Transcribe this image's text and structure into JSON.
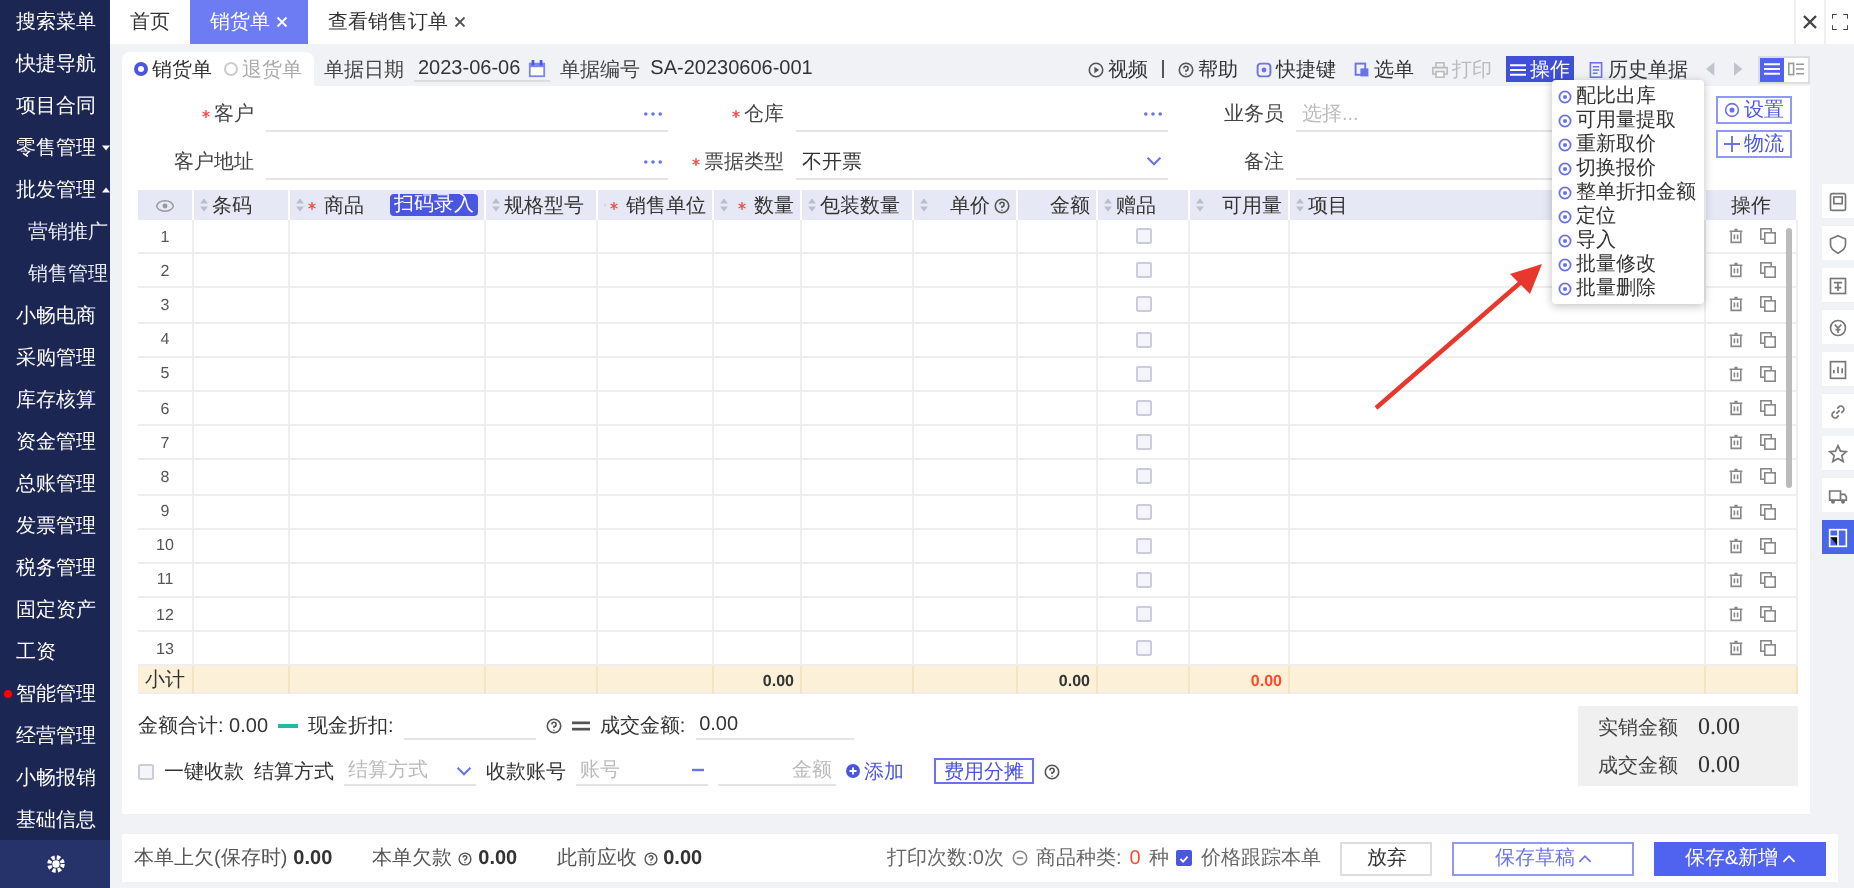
{
  "sidebar": {
    "items": [
      {
        "label": "搜索菜单",
        "notice": false
      },
      {
        "label": "快捷导航",
        "notice": false
      },
      {
        "label": "项目合同",
        "notice": false
      },
      {
        "label": "零售管理",
        "notice": false,
        "expanded": false
      },
      {
        "label": "批发管理",
        "notice": false,
        "expanded": true,
        "children": [
          {
            "label": "营销推广",
            "notice": false
          },
          {
            "label": "销售管理",
            "notice": false
          }
        ]
      },
      {
        "label": "小畅电商",
        "notice": false
      },
      {
        "label": "采购管理",
        "notice": false
      },
      {
        "label": "库存核算",
        "notice": false
      },
      {
        "label": "资金管理",
        "notice": false
      },
      {
        "label": "总账管理",
        "notice": false
      },
      {
        "label": "发票管理",
        "notice": false
      },
      {
        "label": "税务管理",
        "notice": false
      },
      {
        "label": "固定资产",
        "notice": false
      },
      {
        "label": "工资",
        "notice": false
      },
      {
        "label": "智能管理",
        "notice": true
      },
      {
        "label": "经营管理",
        "notice": false
      },
      {
        "label": "小畅报销",
        "notice": false
      },
      {
        "label": "基础信息",
        "notice": false
      }
    ]
  },
  "tabs": [
    {
      "label": "首页",
      "closable": false,
      "selected": false
    },
    {
      "label": "销货单",
      "closable": true,
      "selected": true
    },
    {
      "label": "查看销售订单",
      "closable": true,
      "selected": false
    }
  ],
  "doc_types": [
    {
      "label": "销货单",
      "selected": true
    },
    {
      "label": "退货单",
      "selected": false
    }
  ],
  "doc_date": {
    "label": "单据日期",
    "value": "2023-06-06"
  },
  "doc_number": {
    "label": "单据编号",
    "value": "SA-20230606-001"
  },
  "toolbar": [
    {
      "label": "视频",
      "kind": "video",
      "disabled": false,
      "expanded": false
    },
    {
      "label": "帮助",
      "kind": "help",
      "disabled": false,
      "expanded": false
    },
    {
      "label": "快捷键",
      "kind": "keyboard",
      "disabled": false,
      "expanded": false
    },
    {
      "label": "选单",
      "kind": "list",
      "disabled": false,
      "expanded": false
    },
    {
      "label": "打印",
      "kind": "print",
      "disabled": true,
      "expanded": false
    },
    {
      "label": "操作",
      "kind": "menu",
      "disabled": false,
      "expanded": true
    },
    {
      "label": "历史单据",
      "kind": "history",
      "disabled": false,
      "expanded": false
    }
  ],
  "view_toggle": [
    {
      "kind": "list",
      "selected": true
    },
    {
      "kind": "detail",
      "selected": false
    }
  ],
  "form_rows": [
    [
      {
        "label": "客户",
        "required": true,
        "kind": "lookup"
      },
      {
        "label": "仓库",
        "required": true,
        "kind": "lookup"
      },
      {
        "label": "业务员",
        "required": false,
        "kind": "lookup",
        "placeholder": "选择..."
      }
    ],
    [
      {
        "label": "客户地址",
        "required": false,
        "kind": "lookup"
      },
      {
        "label": "票据类型",
        "required": true,
        "kind": "select",
        "value": "不开票"
      },
      {
        "label": "备注",
        "required": false,
        "kind": "text"
      }
    ]
  ],
  "side_buttons": [
    {
      "label": "设置",
      "kind": "settings"
    },
    {
      "label": "物流",
      "kind": "add"
    }
  ],
  "operation_menu": [
    {
      "label": "配比出库"
    },
    {
      "label": "可用量提取"
    },
    {
      "label": "重新取价"
    },
    {
      "label": "切换报价"
    },
    {
      "label": "整单折扣金额"
    },
    {
      "label": "定位"
    },
    {
      "label": "导入"
    },
    {
      "label": "批量修改"
    },
    {
      "label": "批量删除"
    }
  ],
  "table": {
    "columns": [
      {
        "kind": "index",
        "total": "小计"
      },
      {
        "kind": "text",
        "label": "条码",
        "sortable": true,
        "required": false
      },
      {
        "kind": "text",
        "label": "商品",
        "sortable": true,
        "required": true,
        "badge": "扫码录入"
      },
      {
        "kind": "text",
        "label": "规格型号",
        "sortable": true,
        "required": false
      },
      {
        "kind": "text",
        "label": "销售单位",
        "sortable": true,
        "required": true
      },
      {
        "kind": "number",
        "label": "数量",
        "sortable": true,
        "required": true,
        "total": "0.00",
        "warning": false
      },
      {
        "kind": "text",
        "label": "包装数量",
        "sortable": true,
        "required": false
      },
      {
        "kind": "number",
        "label": "单价",
        "sortable": true,
        "required": false,
        "help": true
      },
      {
        "kind": "number",
        "label": "金额",
        "sortable": false,
        "required": false,
        "total": "0.00",
        "warning": false
      },
      {
        "kind": "check",
        "label": "赠品",
        "sortable": true,
        "required": false
      },
      {
        "kind": "number",
        "label": "可用量",
        "sortable": true,
        "required": false,
        "total": "0.00",
        "warning": true
      },
      {
        "kind": "text",
        "label": "项目",
        "sortable": true,
        "required": false
      },
      {
        "kind": "actions",
        "label": "操作",
        "sortable": false,
        "required": false
      }
    ],
    "rows": [
      {
        "no": "1",
        "gift": false
      },
      {
        "no": "2",
        "gift": false
      },
      {
        "no": "3",
        "gift": false
      },
      {
        "no": "4",
        "gift": false
      },
      {
        "no": "5",
        "gift": false
      },
      {
        "no": "6",
        "gift": false
      },
      {
        "no": "7",
        "gift": false
      },
      {
        "no": "8",
        "gift": false
      },
      {
        "no": "9",
        "gift": false
      },
      {
        "no": "10",
        "gift": false
      },
      {
        "no": "11",
        "gift": false
      },
      {
        "no": "12",
        "gift": false
      },
      {
        "no": "13",
        "gift": false
      }
    ]
  },
  "totals": {
    "sum_label": "金额合计:",
    "sum_value": "0.00",
    "discount_label": "现金折扣:",
    "deal_label": "成交金额:",
    "deal_value": "0.00"
  },
  "summary_box": [
    {
      "label": "实销金额",
      "value": "0.00"
    },
    {
      "label": "成交金额",
      "value": "0.00"
    }
  ],
  "payment": {
    "quick_label": "一键收款",
    "quick_checked": false,
    "method_label": "结算方式",
    "method_placeholder": "结算方式",
    "account_label": "收款账号",
    "account_placeholder": "账号",
    "amount_placeholder": "金额",
    "add_label": "添加",
    "share_label": "费用分摊"
  },
  "footer": {
    "stats": [
      {
        "label": "本单上欠(保存时)",
        "value": "0.00",
        "help": false
      },
      {
        "label": "本单欠款",
        "value": "0.00",
        "help": true
      },
      {
        "label": "此前应收",
        "value": "0.00",
        "help": true
      }
    ],
    "print_count": "打印次数:0次",
    "kinds_label": "商品种类:",
    "kinds_value": "0",
    "kinds_unit": "种",
    "track_label": "价格跟踪本单",
    "track_checked": true,
    "buttons": [
      {
        "label": "放弃",
        "kind": "plain"
      },
      {
        "label": "保存草稿",
        "kind": "outline"
      },
      {
        "label": "保存&新增",
        "kind": "primary"
      }
    ]
  },
  "right_strip": [
    {
      "kind": "card",
      "selected": false
    },
    {
      "kind": "shield",
      "selected": false
    },
    {
      "kind": "box",
      "selected": false
    },
    {
      "kind": "coin",
      "selected": false
    },
    {
      "kind": "report",
      "selected": false
    },
    {
      "kind": "link",
      "selected": false
    },
    {
      "kind": "star",
      "selected": false
    },
    {
      "kind": "truck",
      "selected": false
    },
    {
      "kind": "panel",
      "selected": true
    }
  ]
}
